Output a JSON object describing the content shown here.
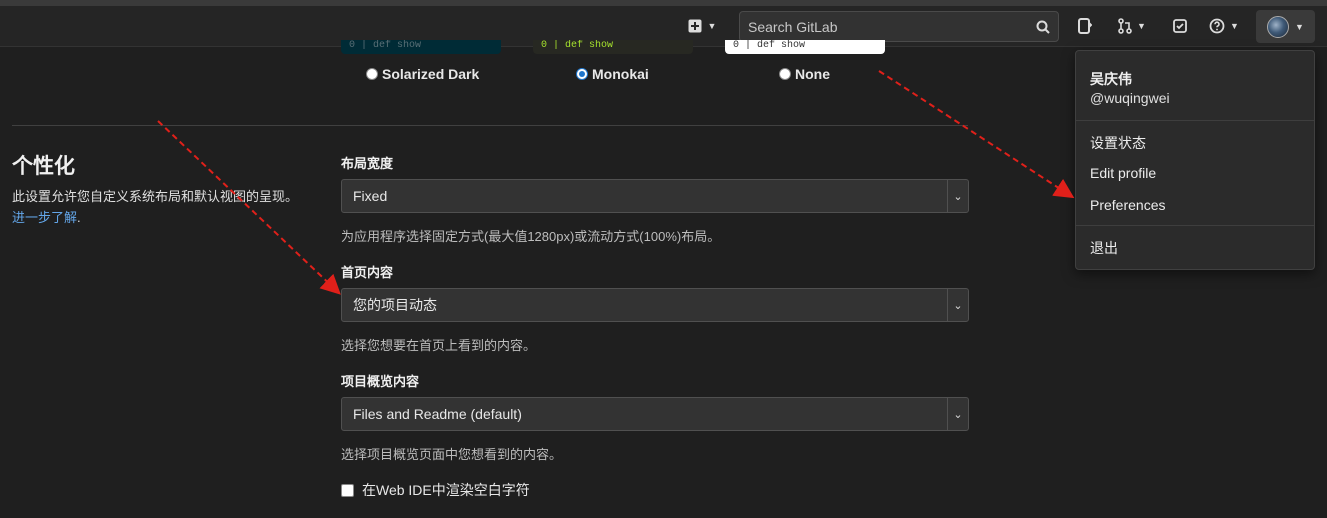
{
  "topbar": {
    "search_placeholder": "Search GitLab"
  },
  "themes": {
    "previews": [
      {
        "line": "0  |  def show"
      },
      {
        "line": "0  |  def show"
      },
      {
        "line": "0  |  def show"
      }
    ],
    "options": [
      {
        "label": "Solarized Dark",
        "checked": false
      },
      {
        "label": "Monokai",
        "checked": true
      },
      {
        "label": "None",
        "checked": false
      }
    ]
  },
  "section": {
    "title": "个性化",
    "desc": "此设置允许您自定义系统布局和默认视图的呈现。",
    "learn_more": "进一步了解",
    "period": "."
  },
  "fields": {
    "layout_width": {
      "label": "布局宽度",
      "value": "Fixed",
      "help": "为应用程序选择固定方式(最大值1280px)或流动方式(100%)布局。"
    },
    "homepage": {
      "label": "首页内容",
      "value": "您的项目动态",
      "help": "选择您想要在首页上看到的内容。"
    },
    "project_overview": {
      "label": "项目概览内容",
      "value": "Files and Readme (default)",
      "help": "选择项目概览页面中您想看到的内容。"
    },
    "whitespace": {
      "label": "在Web IDE中渲染空白字符",
      "checked": false
    }
  },
  "user_menu": {
    "name": "吴庆伟",
    "handle": "@wuqingwei",
    "items": [
      "设置状态",
      "Edit profile",
      "Preferences"
    ],
    "signout": "退出"
  },
  "colors": {
    "background": "#1f1f1f",
    "accent": "#1f75cb",
    "arrow": "#e0201a"
  }
}
